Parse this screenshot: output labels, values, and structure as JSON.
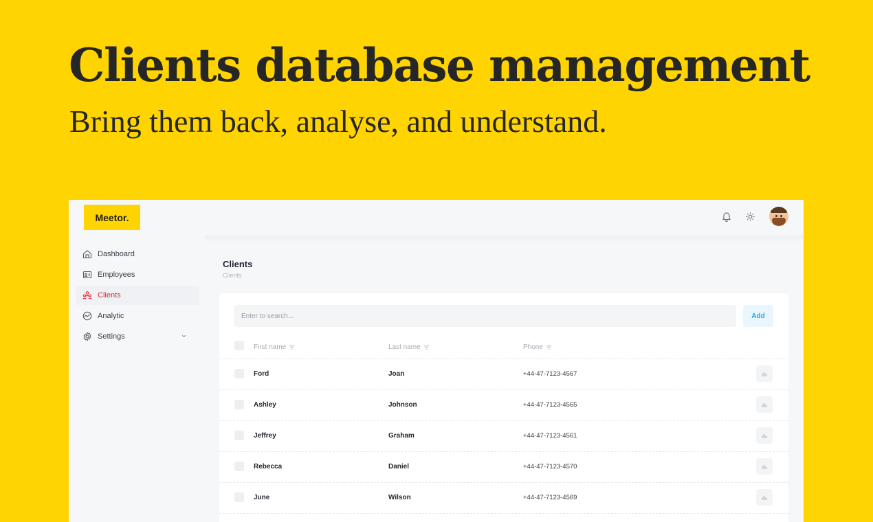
{
  "hero": {
    "title": "Clients database management",
    "subtitle": "Bring them back, analyse, and understand."
  },
  "app": {
    "logo": "Meetor.",
    "topbar_icons": [
      "bell-icon",
      "gear-icon",
      "user-avatar"
    ],
    "sidebar": {
      "items": [
        {
          "label": "Dashboard",
          "icon": "home-icon",
          "active": false
        },
        {
          "label": "Employees",
          "icon": "id-card-icon",
          "active": false
        },
        {
          "label": "Clients",
          "icon": "users-icon",
          "active": true
        },
        {
          "label": "Analytic",
          "icon": "chart-icon",
          "active": false
        },
        {
          "label": "Settings",
          "icon": "gear-icon",
          "active": false,
          "has_dropdown": true
        }
      ]
    },
    "page": {
      "title": "Clients",
      "breadcrumb": "Clients"
    },
    "search": {
      "placeholder": "Enter to search..."
    },
    "add_label": "Add",
    "table": {
      "columns": [
        "First name",
        "Last name",
        "Phone"
      ],
      "rows": [
        {
          "first": "Ford",
          "last": "Joan",
          "phone": "+44-47-7123-4567"
        },
        {
          "first": "Ashley",
          "last": "Johnson",
          "phone": "+44-47-7123-4565"
        },
        {
          "first": "Jeffrey",
          "last": "Graham",
          "phone": "+44-47-7123-4561"
        },
        {
          "first": "Rebecca",
          "last": "Daniel",
          "phone": "+44-47-7123-4570"
        },
        {
          "first": "June",
          "last": "Wilson",
          "phone": "+44-47-7123-4569"
        }
      ]
    }
  },
  "colors": {
    "background": "#FFD400",
    "accent_active": "#E5243B",
    "add_button_text": "#1BA4E6",
    "text_dark": "#262626"
  }
}
